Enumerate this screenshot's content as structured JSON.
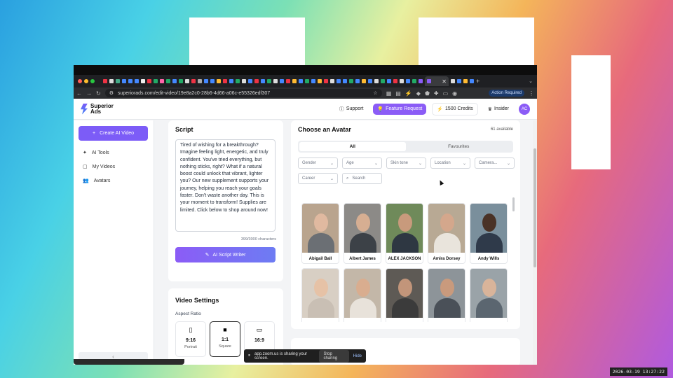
{
  "browser": {
    "url": "superiorads.com/edit-video/19e8a2c0-28b6-4d66-a06c-e55326edf307",
    "action_required": "Action Required"
  },
  "header": {
    "brand_line1": "Superior",
    "brand_line2": "Ads",
    "support": "Support",
    "feature_request": "Feature Request",
    "credits": "1500 Credits",
    "insider": "Insider",
    "user_initials": "AC"
  },
  "sidebar": {
    "create": "Create AI Video",
    "items": [
      {
        "label": "AI Tools"
      },
      {
        "label": "My Videos"
      },
      {
        "label": "Avatars"
      }
    ]
  },
  "script": {
    "title": "Script",
    "text": "Tired of wishing for a breakthrough? Imagine feeling light, energetic, and truly confident. You've tried everything, but nothing sticks, right? What if a natural boost could unlock that vibrant, lighter you? Our new supplement supports your journey, helping you reach your goals faster. Don't waste another day. This is your moment to transform! Supplies are limited. Click below to shop around now!",
    "char_count": "399/3000 characters",
    "ai_writer": "AI Script Writer"
  },
  "video_settings": {
    "title": "Video Settings",
    "aspect_label": "Aspect Ratio",
    "options": [
      {
        "ratio": "9:16",
        "label": "Portrait"
      },
      {
        "ratio": "1:1",
        "label": "Square"
      },
      {
        "ratio": "16:9",
        "label": ""
      }
    ]
  },
  "avatars": {
    "title": "Choose an Avatar",
    "count": "61 available",
    "tabs": [
      "All",
      "Favourites"
    ],
    "filters": [
      "Gender",
      "Age",
      "Skin tone",
      "Location",
      "Camera...",
      "Career"
    ],
    "search_placeholder": "Search",
    "items": [
      {
        "name": "Abigail Ball"
      },
      {
        "name": "Albert James"
      },
      {
        "name": "ALEX JACKSON"
      },
      {
        "name": "Amira Dorsey"
      },
      {
        "name": "Andy Wills"
      },
      {
        "name": ""
      },
      {
        "name": ""
      },
      {
        "name": ""
      },
      {
        "name": ""
      },
      {
        "name": ""
      }
    ]
  },
  "zoom": {
    "sharing": "app.zoom.us is sharing your screen.",
    "stop": "Stop sharing",
    "hide": "Hide"
  },
  "clock": "2026-03-19  13:27:22"
}
